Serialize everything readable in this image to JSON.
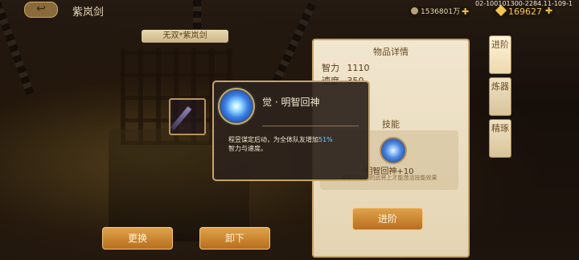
{
  "header": {
    "title": "紫岚剑",
    "back_label": "↩",
    "build_id": "02-100101300-2284.11-109-1"
  },
  "currency": {
    "coins": "1536801万",
    "gems": "169627"
  },
  "weapon": {
    "name_banner": "无双*紫岚剑"
  },
  "actions": {
    "replace_label": "更换",
    "unequip_label": "卸下",
    "upgrade_label": "进阶"
  },
  "info_panel": {
    "header": "物品详情",
    "stats": [
      {
        "name": "智力",
        "value": "1110"
      },
      {
        "name": "速度",
        "value": "350"
      }
    ],
    "skill_header": "技能",
    "skill_name": "明智回神+10",
    "skill_note": "需要在对应的武将上才能激活技能效果"
  },
  "side_tabs": [
    "进阶",
    "炼器",
    "精琢"
  ],
  "popup": {
    "title": "觉 · 明智回神",
    "desc_prefix": "程昱谋定后动，为全体队友增加",
    "desc_highlight": "51%",
    "desc_suffix": "智力与速度。"
  },
  "colors": {
    "accent_gold": "#c7a46a",
    "highlight_cyan": "#5fd7ff",
    "button_orange": "#d08a32"
  }
}
